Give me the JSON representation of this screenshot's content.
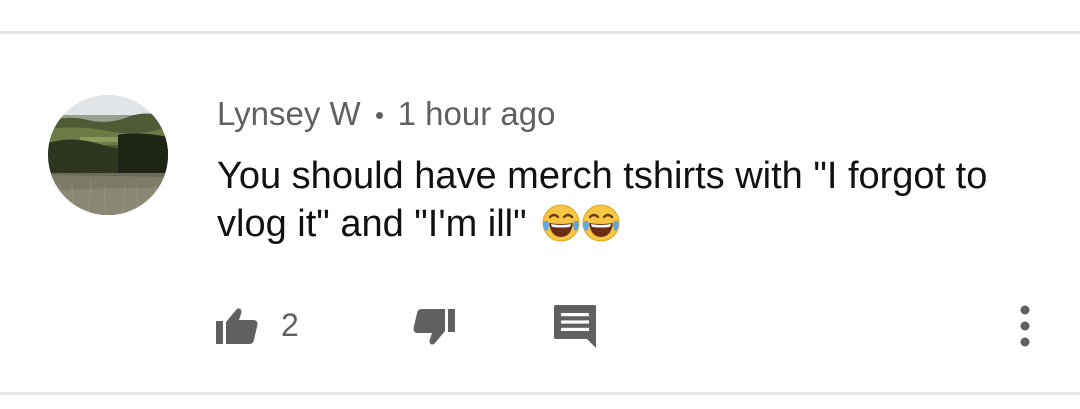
{
  "comment": {
    "author": "Lynsey W",
    "time": "1 hour ago",
    "text": "You should have merch tshirts with \"I forgot to vlog it\" and \"I'm ill\"",
    "emojis": [
      "face-with-tears-of-joy-icon",
      "face-with-tears-of-joy-icon"
    ],
    "like_count": "2"
  },
  "icons": {
    "like": "thumbs-up-icon",
    "dislike": "thumbs-down-icon",
    "reply": "reply-comment-icon",
    "more": "more-vert-icon"
  },
  "colors": {
    "meta_text": "#606060",
    "body_text": "#111111",
    "icon": "#606060",
    "divider": "#e6e6e6"
  }
}
